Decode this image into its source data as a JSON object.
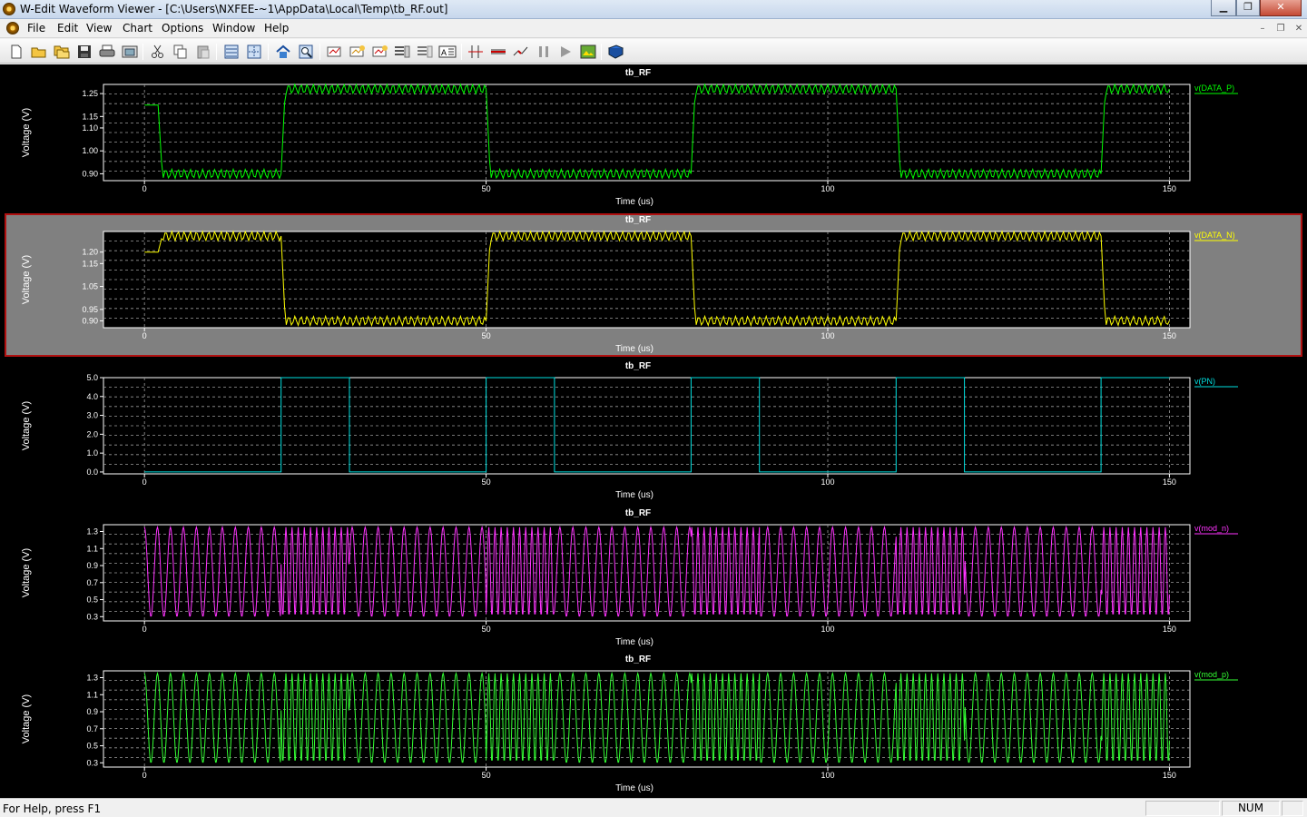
{
  "window": {
    "title": "W-Edit Waveform Viewer - [C:\\Users\\NXFEE-~1\\AppData\\Local\\Temp\\tb_RF.out]",
    "controls": [
      "minimize",
      "restore",
      "close"
    ]
  },
  "menu": {
    "items": [
      "File",
      "Edit",
      "View",
      "Chart",
      "Options",
      "Window",
      "Help"
    ]
  },
  "toolbar": {
    "icons": [
      "new-icon",
      "open-icon",
      "open-multiple-icon",
      "save-icon",
      "print-icon",
      "print-preview-icon",
      "cut-icon",
      "copy-icon",
      "paste-icon",
      "chart-layout-icon",
      "chart-grid-icon",
      "home-icon",
      "zoom-icon",
      "expression-icon",
      "add-trace-icon",
      "edit-trace-icon",
      "chart-stack-icon",
      "chart-separate-icon",
      "text-label-icon",
      "cursor-icon",
      "measure-icon",
      "marker-icon",
      "pause-icon",
      "play-icon",
      "image-icon",
      "book-icon"
    ]
  },
  "chart_data": [
    {
      "type": "line",
      "title": "tb_RF",
      "xlabel": "Time (us)",
      "ylabel": "Voltage (V)",
      "xlim": [
        -6,
        153
      ],
      "ylim": [
        0.87,
        1.29
      ],
      "xticks": [
        "0",
        "50",
        "100",
        "150"
      ],
      "yticks": [
        "0.90",
        "1.00",
        "1.10",
        "1.15",
        "1.25"
      ],
      "ytick_values": [
        0.9,
        1.0,
        1.1,
        1.15,
        1.25
      ],
      "series": [
        {
          "name": "v(DATA_P)",
          "color": "#00ff00",
          "kind": "data",
          "high": 1.27,
          "low": 0.9,
          "start": 1.2,
          "ripple": 0.02,
          "x": [
            0,
            2,
            20,
            50,
            80,
            110,
            140,
            150
          ],
          "y": [
            1.2,
            0.9,
            1.27,
            0.9,
            1.27,
            0.9,
            1.27,
            1.27
          ]
        }
      ],
      "selected": false
    },
    {
      "type": "line",
      "title": "tb_RF",
      "xlabel": "Time (us)",
      "ylabel": "Voltage (V)",
      "xlim": [
        -6,
        153
      ],
      "ylim": [
        0.87,
        1.29
      ],
      "xticks": [
        "0",
        "50",
        "100",
        "150"
      ],
      "yticks": [
        "0.90",
        "0.95",
        "1.05",
        "1.15",
        "1.20"
      ],
      "ytick_values": [
        0.9,
        0.95,
        1.05,
        1.15,
        1.2
      ],
      "series": [
        {
          "name": "v(DATA_N)",
          "color": "#ffff00",
          "kind": "data",
          "high": 1.27,
          "low": 0.9,
          "start": 1.2,
          "ripple": 0.02,
          "x": [
            0,
            2,
            20,
            50,
            80,
            110,
            140,
            150
          ],
          "y": [
            1.2,
            1.27,
            0.9,
            1.27,
            0.9,
            1.27,
            0.9,
            0.9
          ]
        }
      ],
      "selected": true
    },
    {
      "type": "line",
      "title": "tb_RF",
      "xlabel": "Time (us)",
      "ylabel": "Voltage (V)",
      "xlim": [
        -6,
        153
      ],
      "ylim": [
        -0.1,
        5.0
      ],
      "xticks": [
        "0",
        "50",
        "100",
        "150"
      ],
      "yticks": [
        "0.0",
        "1.0",
        "2.0",
        "3.0",
        "4.0",
        "5.0"
      ],
      "ytick_values": [
        0,
        1,
        2,
        3,
        4,
        5
      ],
      "series": [
        {
          "name": "v(PN)",
          "color": "#00e0e0",
          "kind": "pulse",
          "x": [
            0,
            20,
            30,
            50,
            60,
            80,
            90,
            110,
            120,
            140,
            150
          ],
          "y": [
            0,
            5,
            0,
            5,
            0,
            5,
            0,
            5,
            0,
            5,
            5
          ]
        }
      ],
      "selected": false
    },
    {
      "type": "line",
      "title": "tb_RF",
      "xlabel": "Time (us)",
      "ylabel": "Voltage (V)",
      "xlim": [
        -6,
        153
      ],
      "ylim": [
        0.25,
        1.38
      ],
      "xticks": [
        "0",
        "50",
        "100",
        "150"
      ],
      "yticks": [
        "0.3",
        "0.5",
        "0.7",
        "0.9",
        "1.1",
        "1.3"
      ],
      "ytick_values": [
        0.3,
        0.5,
        0.7,
        0.9,
        1.1,
        1.3
      ],
      "series": [
        {
          "name": "v(mod_n)",
          "color": "#ff33ff",
          "kind": "modulated",
          "max": 1.35,
          "min": 0.3,
          "fast_period_us": 0.9,
          "slow_period_us": 1.9
        }
      ],
      "selected": false
    },
    {
      "type": "line",
      "title": "tb_RF",
      "xlabel": "Time (us)",
      "ylabel": "Voltage (V)",
      "xlim": [
        -6,
        153
      ],
      "ylim": [
        0.25,
        1.38
      ],
      "xticks": [
        "0",
        "50",
        "100",
        "150"
      ],
      "yticks": [
        "0.3",
        "0.5",
        "0.7",
        "0.9",
        "1.1",
        "1.3"
      ],
      "ytick_values": [
        0.3,
        0.5,
        0.7,
        0.9,
        1.1,
        1.3
      ],
      "series": [
        {
          "name": "v(mod_p)",
          "color": "#33ff33",
          "kind": "modulated",
          "max": 1.35,
          "min": 0.3,
          "fast_period_us": 0.9,
          "slow_period_us": 1.9
        }
      ],
      "selected": false
    }
  ],
  "status": {
    "help": "For Help, press F1",
    "num": "NUM"
  }
}
